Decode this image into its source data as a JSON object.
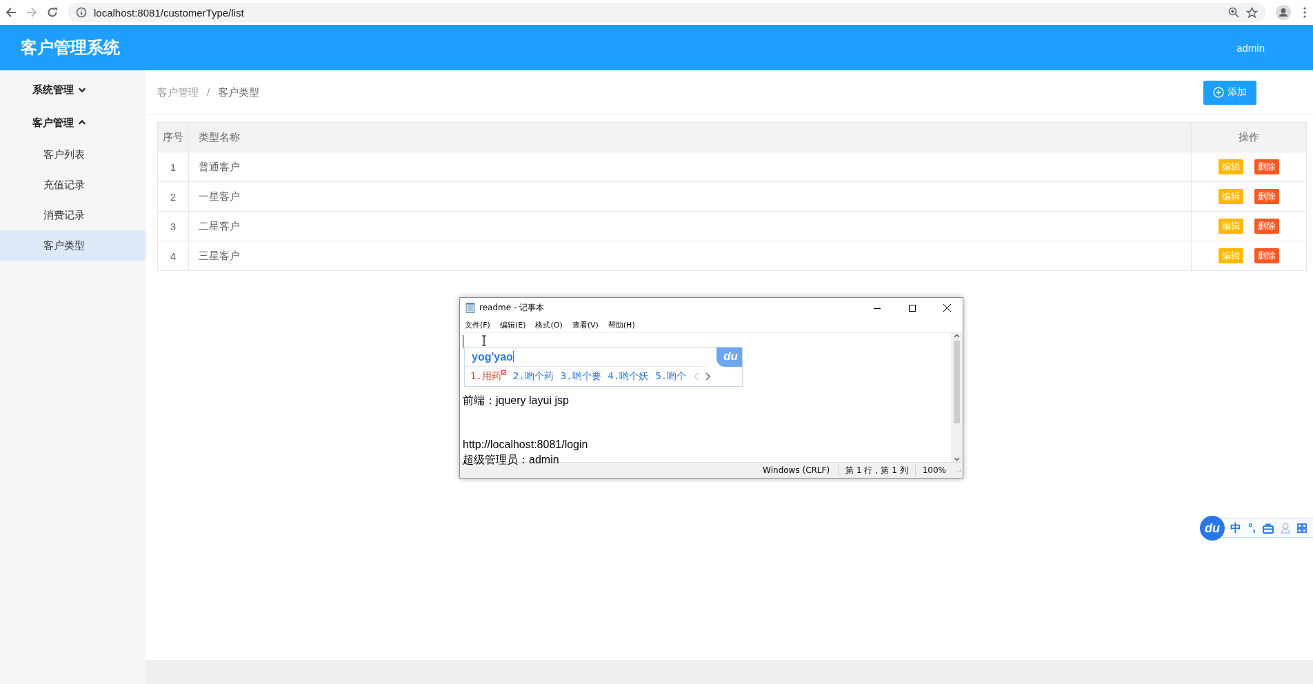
{
  "browser": {
    "url": "localhost:8081/customerType/list"
  },
  "header": {
    "title": "客户管理系统",
    "user": "admin"
  },
  "sidebar": {
    "groups": [
      {
        "label": "系统管理",
        "expanded": false
      },
      {
        "label": "客户管理",
        "expanded": true,
        "children": [
          {
            "label": "客户列表",
            "selected": false
          },
          {
            "label": "充值记录",
            "selected": false
          },
          {
            "label": "消费记录",
            "selected": false
          },
          {
            "label": "客户类型",
            "selected": true
          }
        ]
      }
    ]
  },
  "breadcrumb": {
    "items": [
      "客户管理",
      "客户类型"
    ],
    "separator": "/"
  },
  "add_button": "添加",
  "table": {
    "columns": [
      "序号",
      "类型名称",
      "操作"
    ],
    "rows": [
      {
        "cells": [
          "1",
          "普通客户"
        ],
        "actions": [
          {
            "label": "编辑",
            "kind": "edit"
          },
          {
            "label": "删除",
            "kind": "delete"
          }
        ]
      },
      {
        "cells": [
          "2",
          "一星客户"
        ],
        "actions": [
          {
            "label": "编辑",
            "kind": "edit"
          },
          {
            "label": "删除",
            "kind": "delete"
          }
        ]
      },
      {
        "cells": [
          "3",
          "二星客户"
        ],
        "actions": [
          {
            "label": "编辑",
            "kind": "edit"
          },
          {
            "label": "删除",
            "kind": "delete"
          }
        ]
      },
      {
        "cells": [
          "4",
          "三星客户"
        ],
        "actions": [
          {
            "label": "编辑",
            "kind": "edit"
          },
          {
            "label": "删除",
            "kind": "delete"
          }
        ]
      }
    ]
  },
  "notepad": {
    "title": "readme - 记事本",
    "menu": [
      "文件(F)",
      "编辑(E)",
      "格式(O)",
      "查看(V)",
      "帮助(H)"
    ],
    "paragraphs": [
      [
        "前端：jquery  layui  jsp"
      ],
      [
        "http://localhost:8081/login",
        "超级管理员：admin"
      ]
    ],
    "status": [
      "Windows (CRLF)",
      "第 1 行，第 1 列",
      "100%"
    ]
  },
  "ime_popup": {
    "input": "yog'yao",
    "logo": "du",
    "candidates": [
      {
        "label": "1.用药",
        "selected": true
      },
      {
        "label": "2.哟个药",
        "selected": false
      },
      {
        "label": "3.哟个要",
        "selected": false
      },
      {
        "label": "4.哟个妖",
        "selected": false
      },
      {
        "label": "5.哟个",
        "selected": false
      }
    ]
  },
  "ime_toolbar": {
    "logo": "du",
    "items": [
      "中",
      "°,"
    ]
  }
}
